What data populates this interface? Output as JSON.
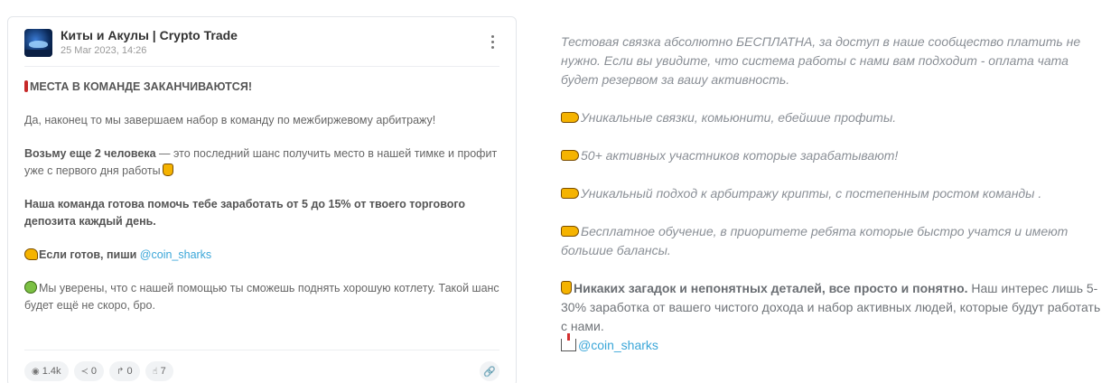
{
  "post": {
    "channel_name": "Киты и Акулы | Crypto Trade",
    "date": "25 Mar 2023, 14:26",
    "headline": "МЕСТА В КОМАНДЕ ЗАКАНЧИВАЮТСЯ!",
    "p1": "Да, наконец то мы завершаем набор в команду по межбиржевому арбитражу!",
    "p2_bold": "Возьму еще 2 человека",
    "p2_rest": " — это последний шанс получить место в нашей тимке и профит уже с первого дня работы",
    "p3_bold": "Наша команда готова помочь тебе заработать от 5 до 15% от твоего торгового депозита каждый день.",
    "p4_bold": "Если готов, пиши ",
    "p4_link": "@coin_sharks",
    "p5": "Мы уверены, что с нашей помощью ты сможешь поднять хорошую котлету. Такой шанс будет ещё не скоро, бро."
  },
  "stats": {
    "views": "1.4k",
    "shares": "0",
    "forwards": "0",
    "likes": "7"
  },
  "icons": {
    "views": "eye-icon",
    "shares": "share-icon",
    "forwards": "forward-icon",
    "likes": "thumbs-up-icon",
    "copy_link": "link-icon",
    "menu": "more-vertical-icon"
  },
  "right": {
    "p1": "Тестовая связка абсолютно БЕСПЛАТНА, за доступ в наше сообщество платить не нужно. Если вы увидите, что система работы с нами вам подходит - оплата чата будет резервом за вашу активность.",
    "b1": "Уникальные связки, комьюнити, ебейшие профиты.",
    "b2": "50+ активных участников которые зарабатывают!",
    "b3": "Уникальный подход к арбитражу крипты, с постепенным ростом команды .",
    "b4": "Бесплатное обучение, в приоритете ребята которые быстро учатся и имеют большие балансы.",
    "p_bold": "Никаких загадок и непонятных деталей, все просто и понятно.",
    "p_rest": " Наш интерес лишь 5-30% заработка от вашего чистого дохода и набор активных людей, которые будут работать с нами.",
    "link": "@coin_sharks"
  },
  "colors": {
    "link": "#3aa6d8",
    "card_border": "#e3e6ea"
  }
}
